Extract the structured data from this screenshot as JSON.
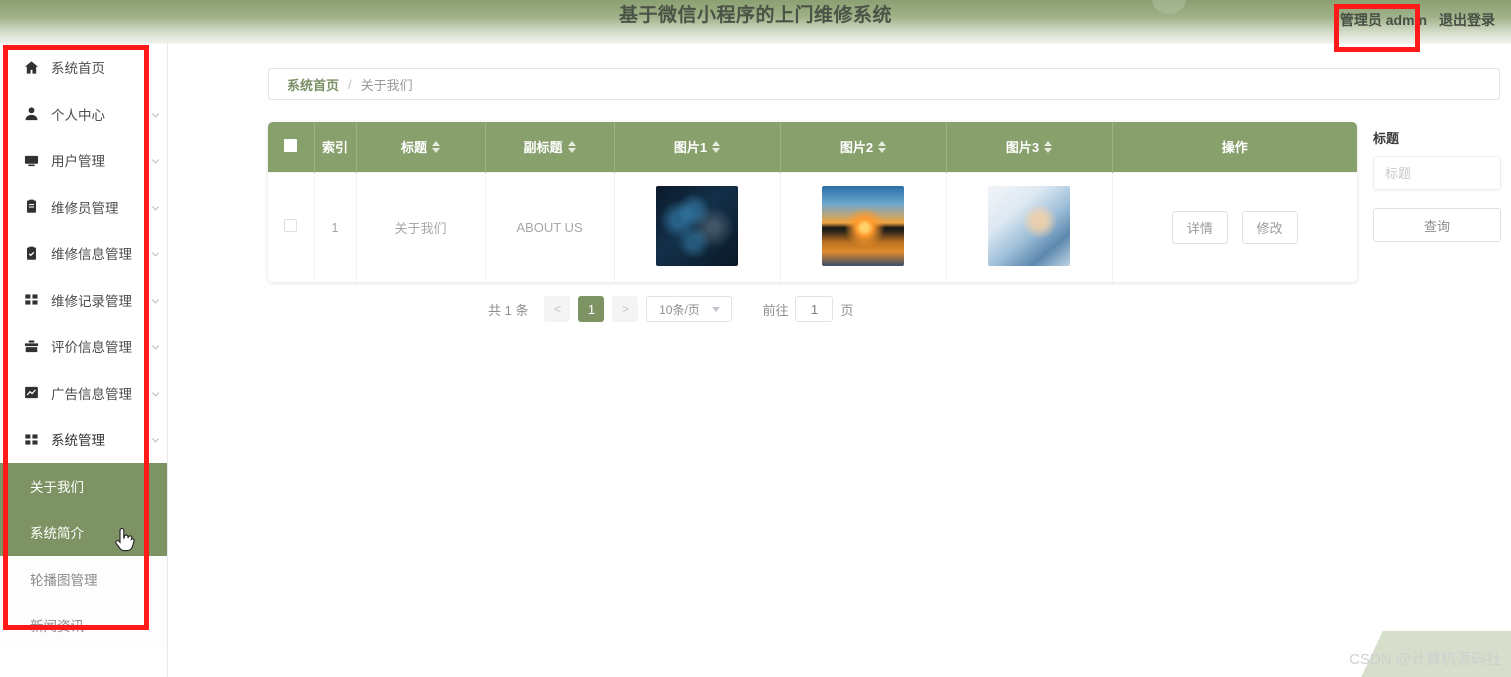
{
  "header": {
    "title": "基于微信小程序的上门维修系统",
    "user_name": "管理员 admin",
    "logout_label": "退出登录"
  },
  "sidebar": {
    "items": [
      {
        "label": "系统首页",
        "icon": "home-icon",
        "has_arrow": false
      },
      {
        "label": "个人中心",
        "icon": "user-icon",
        "has_arrow": true
      },
      {
        "label": "用户管理",
        "icon": "monitor-icon",
        "has_arrow": true
      },
      {
        "label": "维修员管理",
        "icon": "clipboard-icon",
        "has_arrow": true
      },
      {
        "label": "维修信息管理",
        "icon": "clipboard-check-icon",
        "has_arrow": true
      },
      {
        "label": "维修记录管理",
        "icon": "grid-icon",
        "has_arrow": true
      },
      {
        "label": "评价信息管理",
        "icon": "briefcase-icon",
        "has_arrow": true
      },
      {
        "label": "广告信息管理",
        "icon": "chart-icon",
        "has_arrow": true
      },
      {
        "label": "系统管理",
        "icon": "grid-icon",
        "has_arrow": true
      }
    ],
    "submenu": [
      {
        "label": "关于我们",
        "selected": true
      },
      {
        "label": "系统简介",
        "selected": true
      },
      {
        "label": "轮播图管理",
        "selected": false
      },
      {
        "label": "新闻资讯",
        "selected": false
      }
    ]
  },
  "breadcrumb": {
    "home": "系统首页",
    "separator": "/",
    "current": "关于我们"
  },
  "table": {
    "columns": [
      {
        "label": "",
        "sortable": false,
        "type": "checkbox"
      },
      {
        "label": "索引",
        "sortable": false
      },
      {
        "label": "标题",
        "sortable": true
      },
      {
        "label": "副标题",
        "sortable": true
      },
      {
        "label": "图片1",
        "sortable": true
      },
      {
        "label": "图片2",
        "sortable": true
      },
      {
        "label": "图片3",
        "sortable": true
      },
      {
        "label": "操作",
        "sortable": false
      }
    ],
    "rows": [
      {
        "index": "1",
        "title": "关于我们",
        "subtitle": "ABOUT US",
        "image1": "tech-network-photo",
        "image2": "sunset-tree-photo",
        "image3": "business-tablet-photo",
        "actions": [
          "详情",
          "修改"
        ]
      }
    ]
  },
  "pagination": {
    "total_text": "共 1 条",
    "prev": "<",
    "pages": [
      "1"
    ],
    "next": ">",
    "page_size": "10条/页",
    "jump_prefix": "前往",
    "jump_value": "1",
    "jump_suffix": "页"
  },
  "search_panel": {
    "label": "标题",
    "placeholder": "标题",
    "value": "",
    "button": "查询"
  },
  "watermark": "CSDN @计算机源码社",
  "colors": {
    "brand_green": "#88a06c",
    "menu_selected": "#7d9363",
    "annotation_red": "#ff1a1a",
    "header_gradient_top": "#8ba072"
  }
}
